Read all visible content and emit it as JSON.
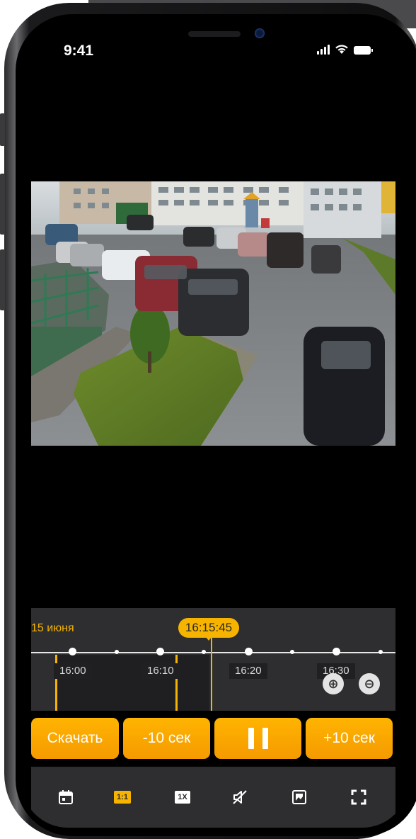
{
  "status_bar": {
    "time": "9:41"
  },
  "timeline": {
    "date": "15 июня",
    "current_time": "16:15:45",
    "ticks": [
      "16:00",
      "16:10",
      "16:20",
      "16:30"
    ]
  },
  "controls": {
    "download": "Скачать",
    "back10": "-10 сек",
    "forward10": "+10 сек"
  },
  "toolbar": {
    "ratio_label": "1:1",
    "speed_label": "1X"
  },
  "colors": {
    "accent": "#f6b400",
    "panel": "#2e2e30",
    "button": "#ffa800"
  },
  "icons": [
    "calendar-icon",
    "ratio-icon",
    "speed-icon",
    "mute-icon",
    "screenshot-icon",
    "fullscreen-icon",
    "pause-icon",
    "zoom-in-icon",
    "zoom-out-icon",
    "signal-icon",
    "wifi-icon",
    "battery-icon"
  ]
}
